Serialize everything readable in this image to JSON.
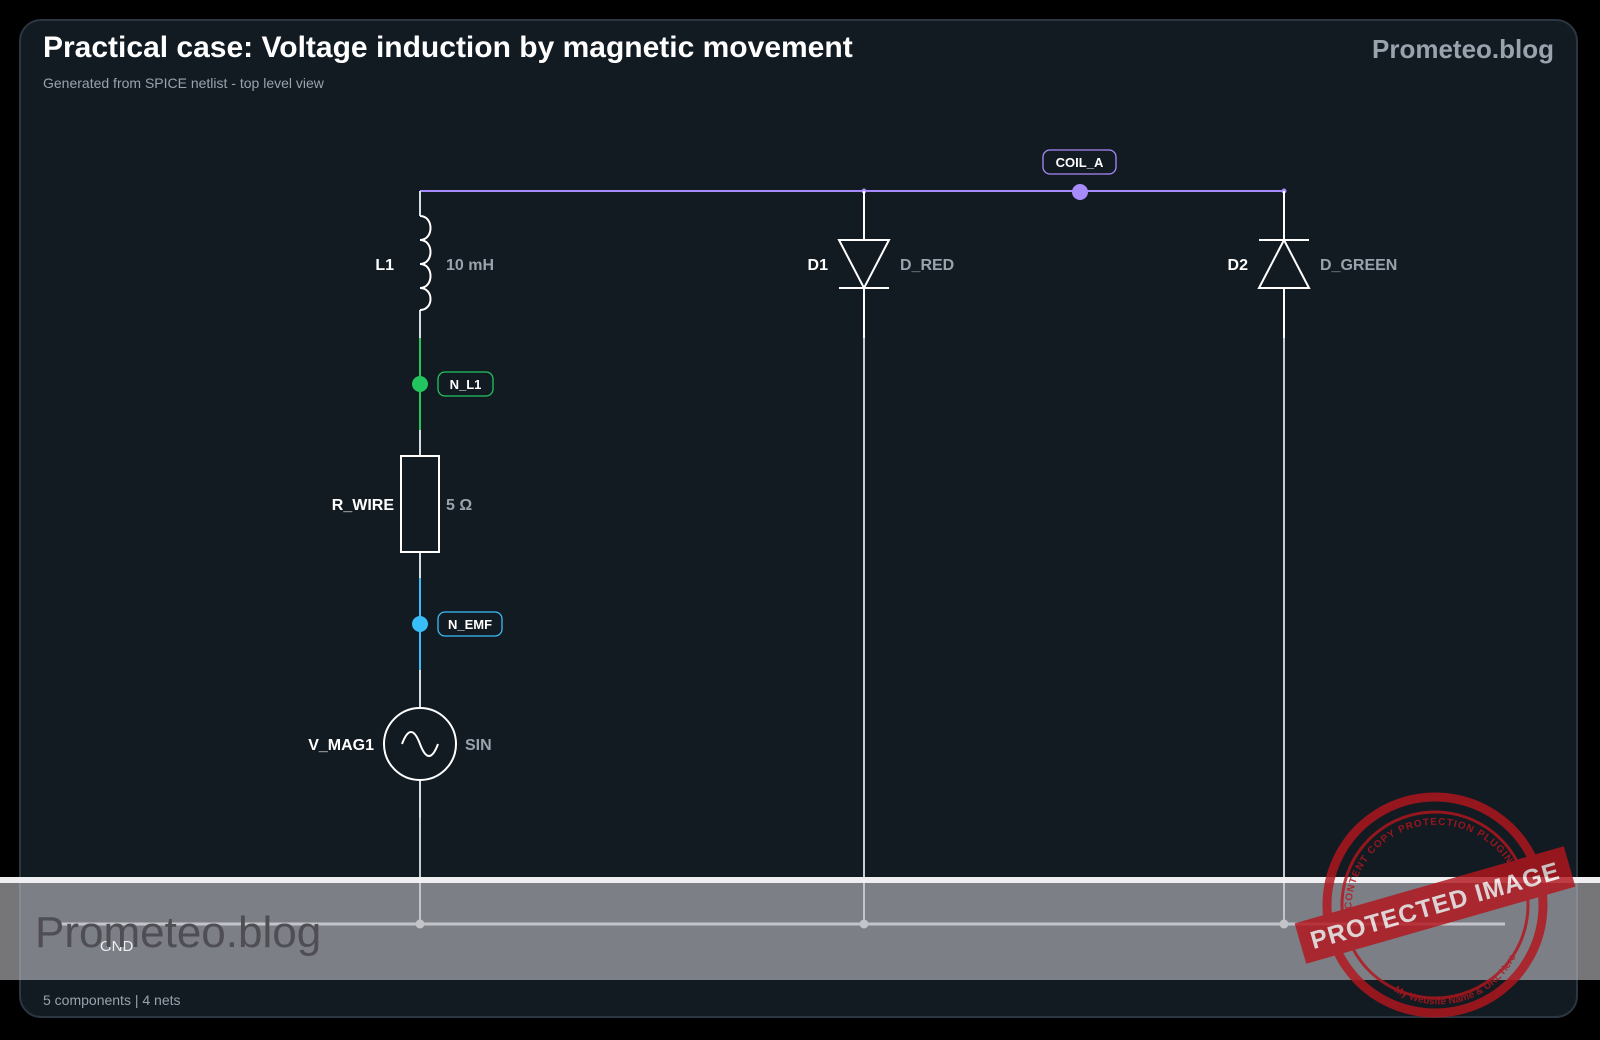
{
  "header": {
    "title": "Practical case: Voltage induction by magnetic movement",
    "subtitle": "Generated from SPICE netlist - top level view",
    "brand": "Prometeo.blog"
  },
  "footer": {
    "summary": "5 components | 4 nets"
  },
  "components": {
    "l1": {
      "ref": "L1",
      "value": "10 mH"
    },
    "r_wire": {
      "ref": "R_WIRE",
      "value": "5 Ω"
    },
    "v_mag1": {
      "ref": "V_MAG1",
      "value": "SIN"
    },
    "d1": {
      "ref": "D1",
      "value": "D_RED"
    },
    "d2": {
      "ref": "D2",
      "value": "D_GREEN"
    }
  },
  "nets": {
    "coil_a": {
      "label": "COIL_A",
      "color": "#a78bfa"
    },
    "n_l1": {
      "label": "N_L1",
      "color": "#22c55e"
    },
    "n_emf": {
      "label": "N_EMF",
      "color": "#38bdf8"
    },
    "gnd": {
      "label": "GND",
      "color": "#c8ccd2"
    }
  },
  "watermark": {
    "text": "Prometeo.blog",
    "stamp_main": "PROTECTED IMAGE",
    "stamp_top": "CONTENT COPY PROTECTION PLUGIN",
    "stamp_bottom": "My Website Name & URL Here",
    "stamp_color": "#b4161e"
  }
}
